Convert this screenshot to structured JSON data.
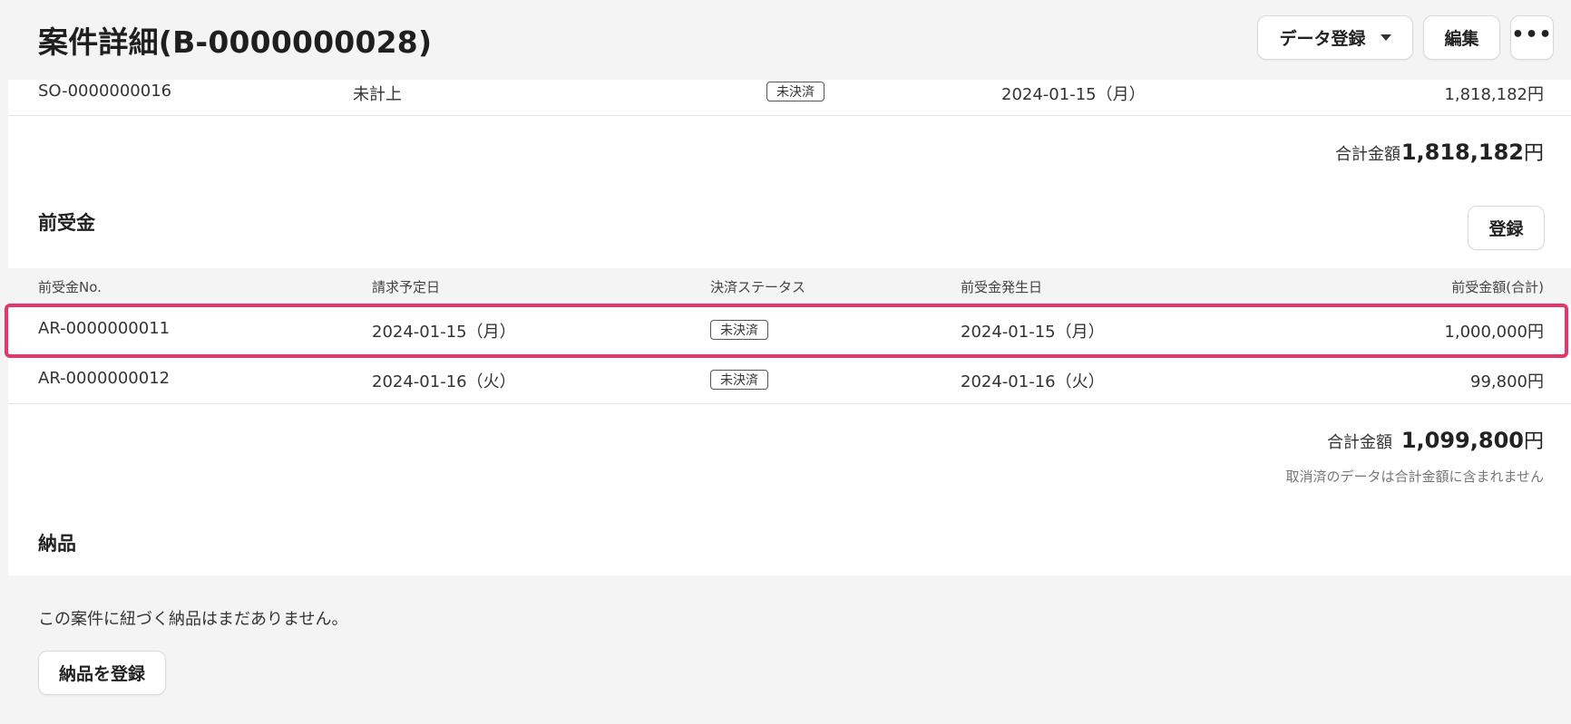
{
  "header": {
    "title": "案件詳細(B-0000000028)",
    "data_register_label": "データ登録",
    "edit_label": "編集",
    "more_label": "•••"
  },
  "sales_order_row": {
    "number": "SO-0000000016",
    "status_text": "未計上",
    "badge": "未決済",
    "date": "2024-01-15（月）",
    "amount": "1,818,182円"
  },
  "sales_total": {
    "label": "合計金額",
    "value": "1,818,182",
    "unit": "円"
  },
  "advance": {
    "title": "前受金",
    "register_label": "登録",
    "columns": [
      "前受金No.",
      "請求予定日",
      "決済ステータス",
      "前受金発生日",
      "前受金額(合計)"
    ],
    "rows": [
      {
        "number": "AR-0000000011",
        "billing_date": "2024-01-15（月）",
        "status": "未決済",
        "occurred_date": "2024-01-15（月）",
        "amount": "1,000,000円"
      },
      {
        "number": "AR-0000000012",
        "billing_date": "2024-01-16（火）",
        "status": "未決済",
        "occurred_date": "2024-01-16（火）",
        "amount": "99,800円"
      }
    ],
    "total": {
      "label": "合計金額",
      "value": "1,099,800",
      "unit": "円"
    },
    "note": "取消済のデータは合計金額に含まれません"
  },
  "delivery": {
    "title": "納品",
    "empty_message": "この案件に紐づく納品はまだありません。",
    "register_label": "納品を登録"
  },
  "colors": {
    "highlight": "#e8336b",
    "background": "#f5f4f5"
  }
}
